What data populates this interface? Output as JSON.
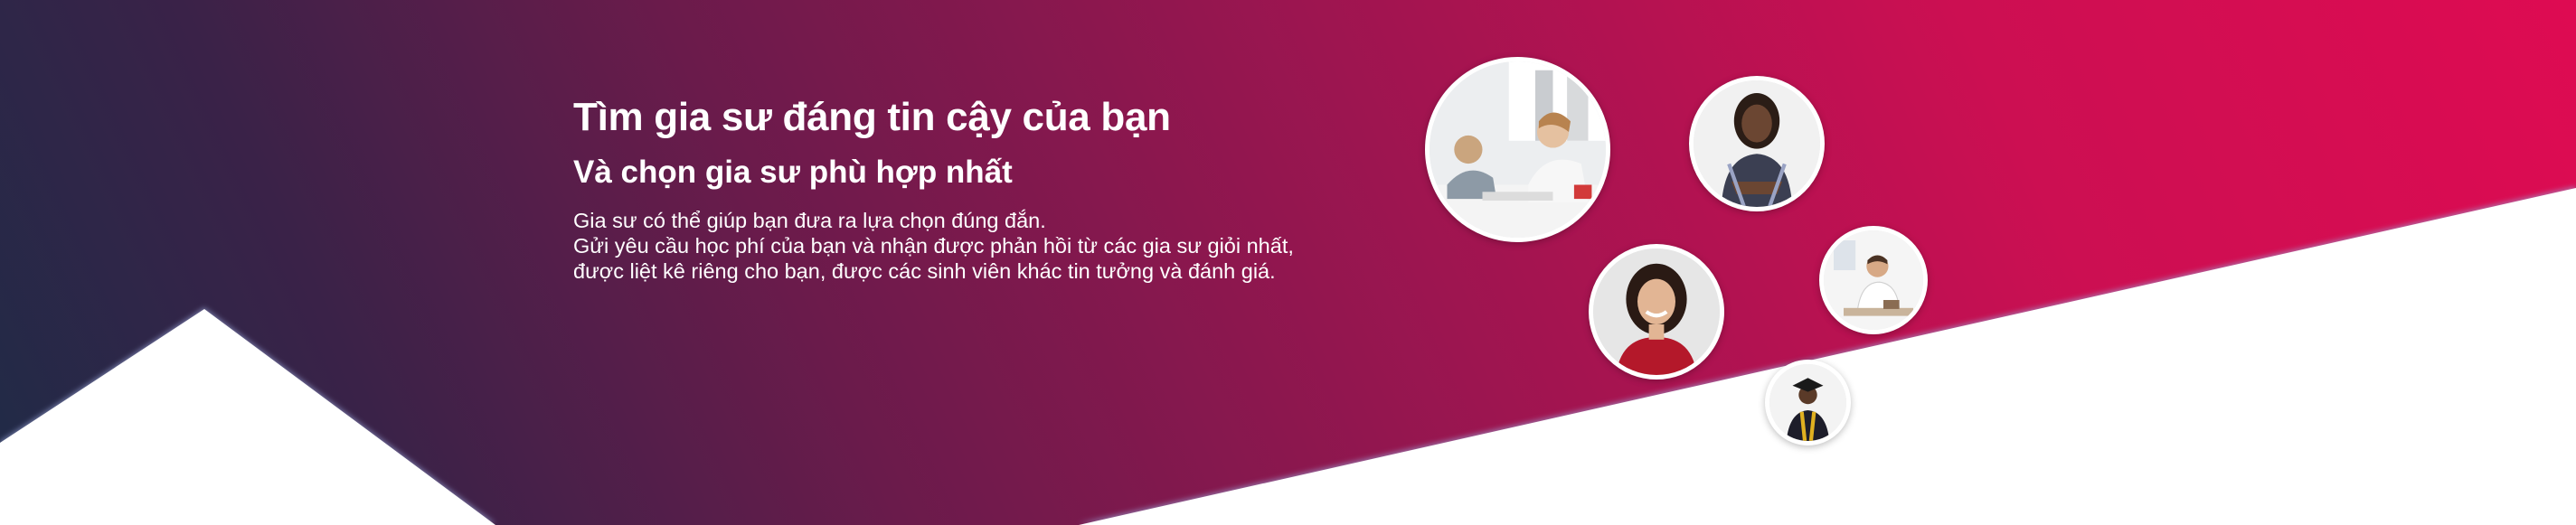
{
  "hero": {
    "title": "Tìm gia sư đáng tin cậy của bạn",
    "subtitle": "Và chọn gia sư phù hợp nhất",
    "description": [
      "Gia sư có thể giúp bạn đưa ra lựa chọn đúng đắn.",
      "Gửi yêu cầu học phí của bạn và nhận được phản hồi từ các gia sư giỏi nhất,",
      "được liệt kê riêng cho bạn, được các sinh viên khác tin tưởng và đánh giá."
    ]
  },
  "colors": {
    "gradient_start": "#de0b52",
    "gradient_end": "#1f2b47",
    "text": "#ffffff"
  },
  "avatars": [
    {
      "icon": "students-studying-photo"
    },
    {
      "icon": "woman-arms-crossed-photo"
    },
    {
      "icon": "smiling-woman-red-top-photo"
    },
    {
      "icon": "man-at-desk-photo"
    },
    {
      "icon": "graduate-photo"
    }
  ]
}
